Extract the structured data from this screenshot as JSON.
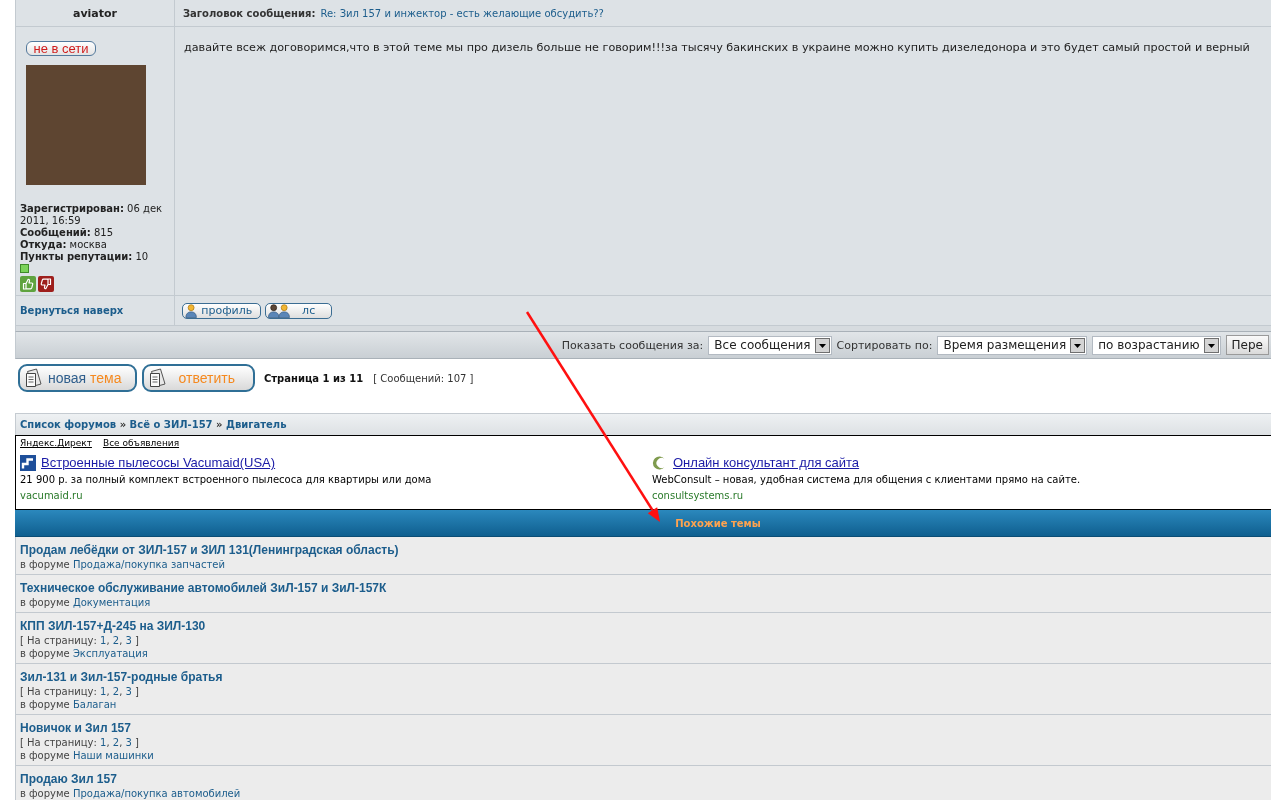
{
  "post": {
    "author": "aviator",
    "subject_label": "Заголовок сообщения:",
    "subject": "Re: Зил 157 и инжектор - есть желающие обсудить??",
    "status": {
      "label": "не в сети",
      "online": false
    },
    "profile_fields": [
      "**Зарегистрирован:** 06 дек 2011, 16:59",
      "**Сообщений:** 815",
      "**Откуда:** москва",
      "**Пункты репутации:** 10"
    ],
    "message": "давайте всеж договоримся,что в этой теме мы про дизель больше не говорим!!!за тысячу бакинских в украине можно купить дизеледонора и это будет самый простой и верный",
    "back_to_top": "Вернуться наверх",
    "buttons": [
      {
        "kind": "profile",
        "label": "профиль"
      },
      {
        "kind": "pm",
        "label": "лс"
      }
    ]
  },
  "display_options": {
    "controls": [
      {
        "kind": "label",
        "text": "Показать сообщения за:"
      },
      {
        "kind": "select",
        "value": "Все сообщения"
      },
      {
        "kind": "label",
        "text": "Сортировать по:"
      },
      {
        "kind": "select",
        "value": "Время размещения"
      },
      {
        "kind": "select",
        "value": "по возрастанию"
      },
      {
        "kind": "button",
        "label": "Пере"
      }
    ]
  },
  "actions": {
    "buttons": [
      {
        "kind": "new_topic",
        "parts": [
          {
            "text": "новая",
            "accent": false
          },
          {
            "text": "тема",
            "accent": true
          }
        ]
      },
      {
        "kind": "reply",
        "parts": [
          {
            "text": "ответить",
            "accent": true
          }
        ]
      }
    ],
    "page": "Страница 1 из 11",
    "posts": "[ Сообщений: 107 ]"
  },
  "breadcrumb": {
    "separator": "»",
    "items": [
      "Список форумов",
      "Всё о ЗИЛ-157",
      "Двигатель"
    ]
  },
  "ads": {
    "links": [
      "Яндекс.Директ",
      "Все объявления"
    ],
    "items": [
      {
        "title": "Встроенные пылесосы Vacumaid(USA)",
        "text": "21 900 р. за полный комплект встроенного пылесоса для квартиры или дома",
        "domain": "vacumaid.ru"
      },
      {
        "title": "Онлайн консультант для сайта",
        "text": "WebConsult – новая, удобная система для общения с клиентами прямо на сайте.",
        "domain": "consultsystems.ru"
      }
    ]
  },
  "similar": {
    "title": "Похожие темы",
    "topics": [
      {
        "title": "Продам лебёдки от ЗИЛ-157 и ЗИЛ 131(Ленинградская область)",
        "forum_prefix": "в форуме",
        "forum": "Продажа/покупка запчастей"
      },
      {
        "title": "Техническое обслуживание автомобилей ЗиЛ-157 и ЗиЛ-157К",
        "forum_prefix": "в форуме",
        "forum": "Документация"
      },
      {
        "title": "КПП ЗИЛ-157+Д-245 на ЗИЛ-130",
        "page_jump": {
          "prefix": "[ На страницу:",
          "pages": [
            "1",
            "2",
            "3"
          ],
          "separator": ",",
          "suffix": "]"
        },
        "forum_prefix": "в форуме",
        "forum": "Эксплуатация"
      },
      {
        "title": "Зил-131 и Зил-157-родные братья",
        "page_jump": {
          "prefix": "[ На страницу:",
          "pages": [
            "1",
            "2",
            "3"
          ],
          "separator": ",",
          "suffix": "]"
        },
        "forum_prefix": "в форуме",
        "forum": "Балаган"
      },
      {
        "title": "Новичок и Зил 157",
        "page_jump": {
          "prefix": "[ На страницу:",
          "pages": [
            "1",
            "2",
            "3"
          ],
          "separator": ",",
          "suffix": "]"
        },
        "forum_prefix": "в форуме",
        "forum": "Наши машинки"
      },
      {
        "title": "Продаю Зил 157",
        "forum_prefix": "в форуме",
        "forum": "Продажа/покупка автомобилей"
      }
    ]
  }
}
